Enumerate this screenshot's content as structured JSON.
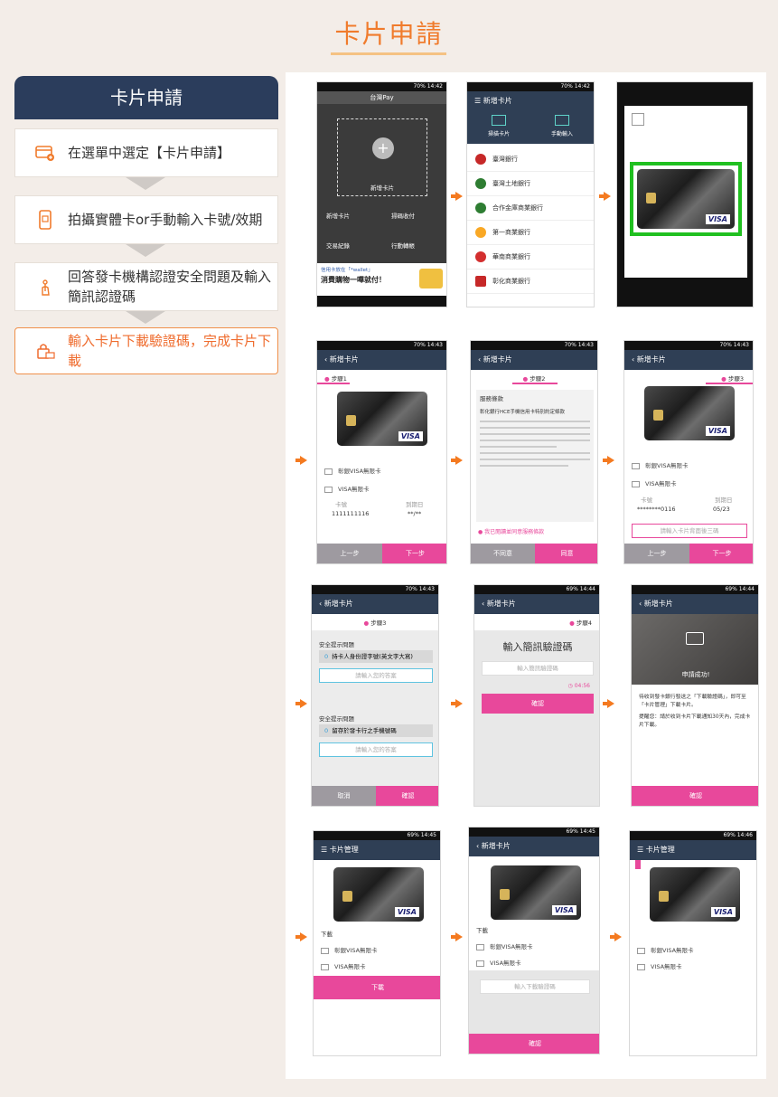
{
  "page": {
    "title": "卡片申請"
  },
  "steps": {
    "header": "卡片申請",
    "items": [
      {
        "text": "在選單中選定【卡片申請】"
      },
      {
        "text": "拍攝實體卡or手動輸入卡號/效期"
      },
      {
        "text": "回答發卡機構認證安全問題及輸入簡訊認證碼"
      },
      {
        "text": "輸入卡片下載驗證碼，完成卡片下載"
      }
    ]
  },
  "phone1": {
    "status": "70% 14:42",
    "app_name": "台灣Pay",
    "add_card": "新增卡片",
    "menu": [
      "新增卡片",
      "掃碼收付",
      "交易紀錄",
      "行動轉帳"
    ],
    "banner_line1": "信用卡放在「*wallet」",
    "banner_line2": "消費購物一嗶就付！"
  },
  "phone2": {
    "status": "70% 14:42",
    "title": "新增卡片",
    "tab_scan": "掃描卡片",
    "tab_manual": "手動輸入",
    "banks": [
      "臺灣銀行",
      "臺灣土地銀行",
      "合作金庫商業銀行",
      "第一商業銀行",
      "華南商業銀行",
      "彰化商業銀行"
    ]
  },
  "phone4": {
    "status": "70% 14:43",
    "title": "新增卡片",
    "step": "步驟1",
    "field1": "彰銀VISA無限卡",
    "field2": "VISA無限卡",
    "label_card": "卡號",
    "label_exp": "到期日",
    "card_no": "1111111116",
    "exp": "**/**",
    "btn_prev": "上一步",
    "btn_next": "下一步"
  },
  "phone5": {
    "status": "70% 14:43",
    "title": "新增卡片",
    "step": "步驟2",
    "terms_title": "服務條款",
    "terms_body": "彰化銀行HCE手機信用卡特別約定條款",
    "agree_check": "我已閱讀並同意服務條款",
    "btn_disagree": "不同意",
    "btn_agree": "同意"
  },
  "phone6": {
    "status": "70% 14:43",
    "title": "新增卡片",
    "step": "步驟3",
    "field1": "彰銀VISA無限卡",
    "field2": "VISA無限卡",
    "label_card": "卡號",
    "label_exp": "到期日",
    "card_no": "********0116",
    "exp": "05/23",
    "input_placeholder": "請輸入卡片背面後三碼",
    "btn_prev": "上一步",
    "btn_next": "下一步"
  },
  "phone7": {
    "status": "70% 14:43",
    "title": "新增卡片",
    "step": "步驟3",
    "q_label1": "安全提示問題",
    "q1": "持卡人身份證字號(英文字大寫)",
    "q_label2": "安全提示問題",
    "q2": "留存於發卡行之手機號碼",
    "answer_placeholder": "請輸入您的答案",
    "btn_cancel": "取消",
    "btn_confirm": "確認"
  },
  "phone8": {
    "status": "69% 14:44",
    "title": "新增卡片",
    "step": "步驟4",
    "heading": "輸入簡訊驗證碼",
    "input_placeholder": "輸入簡訊驗證碼",
    "timer": "04:56",
    "btn_confirm": "確認"
  },
  "phone9": {
    "status": "69% 14:44",
    "title": "新增卡片",
    "success": "申請成功!",
    "message": "待收到發卡銀行發送之「下載驗證碼」，即可至「卡片管理」下載卡片。",
    "note": "提醒您：請於收到卡片下載通知30天內，完成卡片下載。",
    "btn_confirm": "確認"
  },
  "phone10": {
    "status": "69% 14:45",
    "title": "卡片管理",
    "download_label": "下載",
    "field1": "彰銀VISA無限卡",
    "field2": "VISA無限卡",
    "btn_download": "下載"
  },
  "phone11": {
    "status": "69% 14:45",
    "title": "新增卡片",
    "download_label": "下載",
    "field1": "彰銀VISA無限卡",
    "field2": "VISA無限卡",
    "input_placeholder": "輸入下載驗證碼",
    "btn_confirm": "確認"
  },
  "phone12": {
    "status": "69% 14:46",
    "title": "卡片管理",
    "field1": "彰銀VISA無限卡",
    "field2": "VISA無限卡"
  },
  "card_brand": "VISA",
  "colors": {
    "accent": "#f07b2c",
    "navy": "#2b3d5c",
    "pink": "#e8489b"
  }
}
